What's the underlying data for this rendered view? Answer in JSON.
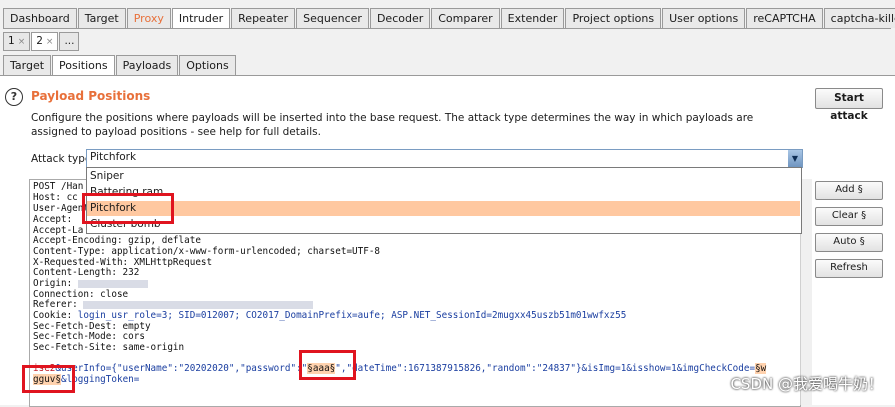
{
  "main_tabs": [
    "Dashboard",
    "Target",
    "Proxy",
    "Intruder",
    "Repeater",
    "Sequencer",
    "Decoder",
    "Comparer",
    "Extender",
    "Project options",
    "User options",
    "reCAPTCHA",
    "captcha-killer"
  ],
  "sub_tabs": [
    {
      "label": "1",
      "close": "×"
    },
    {
      "label": "2",
      "close": "×"
    },
    {
      "label": "..."
    }
  ],
  "section_tabs": [
    "Target",
    "Positions",
    "Payloads",
    "Options"
  ],
  "panel": {
    "title": "Payload Positions",
    "description": "Configure the positions where payloads will be inserted into the base request. The attack type determines the way in which payloads are assigned to payload positions - see help for full details.",
    "start_attack": "Start attack",
    "attack_type_label": "Attack type:",
    "attack_type_value": "Pitchfork",
    "attack_type_options": [
      "Sniper",
      "Battering ram",
      "Pitchfork",
      "Cluster bomb"
    ]
  },
  "request": {
    "l1": "POST /Han",
    "l2": "Host: cc",
    "l3": "User-Agent",
    "l4": "Accept: ",
    "l5": "Accept-La",
    "l6": "Accept-Encoding: gzip, deflate",
    "l7": "Content-Type: application/x-www-form-urlencoded; charset=UTF-8",
    "l8": "X-Requested-With: XMLHttpRequest",
    "l9": "Content-Length: 232",
    "l10": "Origin: ",
    "l11": "Connection: close",
    "l12": "Referer: ",
    "l13_a": "Cookie: ",
    "l13_b": "login_usr_role=3; SID=012007; CO2017_DomainPrefix=aufe; ASP.NET_SessionId=2mugxx45uszb51m01wwfxz55",
    "l14": "Sec-Fetch-Dest: empty",
    "l15": "Sec-Fetch-Mode: cors",
    "l16": "Sec-Fetch-Site: same-origin",
    "body_a": "ise2",
    "body_b": "&userInfo={\"userName\":\"20202020\",\"password\":",
    "body_c": "\"",
    "body_d": "§aaa§",
    "body_e": "\",\"dateTime\":1671387915826,\"random\":\"24837\"}&isImg=1&isshow=1&imgCheckCode=",
    "body_f": "§w",
    "body_g": "gguv§",
    "body_h": "&loggingToken="
  },
  "side_buttons": [
    "Add §",
    "Clear §",
    "Auto §",
    "Refresh"
  ],
  "watermark": "CSDN @我爱喝牛奶！"
}
